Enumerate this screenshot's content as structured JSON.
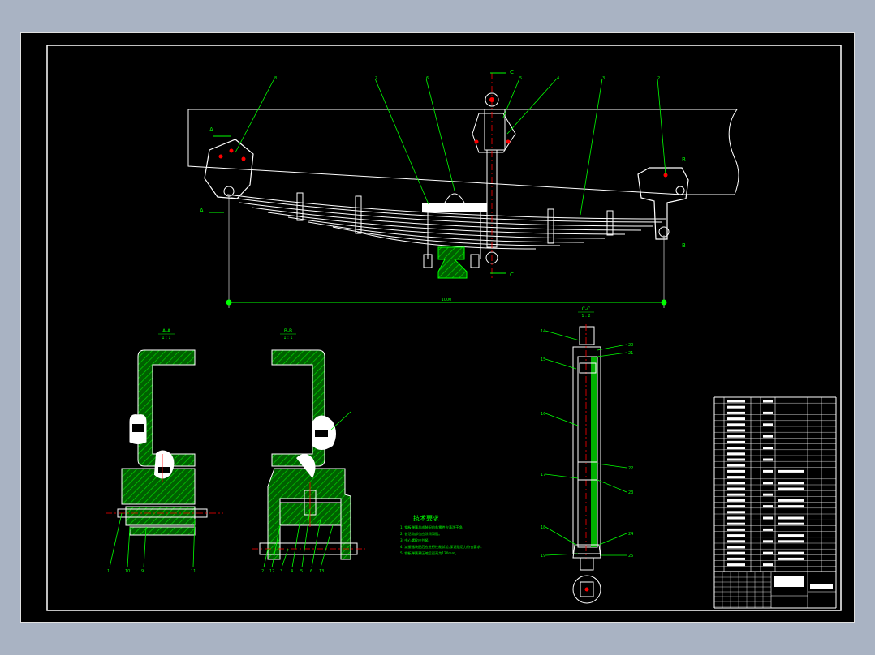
{
  "drawing": {
    "section_cc": {
      "title": "C-C",
      "scale": "1 : 2"
    },
    "section_aa": {
      "title": "A-A",
      "scale": "1 : 1"
    },
    "section_bb": {
      "title": "B-B",
      "scale": "1 : 1"
    },
    "top_labels": [
      "8",
      "7",
      "6",
      "5",
      "4",
      "3",
      "2",
      "1"
    ],
    "cut_marks": {
      "top_c": "C",
      "bottom_c": "C",
      "right_b_top": "B",
      "right_b_bottom": "B",
      "left_a_top": "A",
      "left_a_bottom": "A"
    },
    "dimension": "1000",
    "tech_req": {
      "title": "技术要求",
      "items": [
        "1. 钢板弹簧总成装配前各零件应清洗干净。",
        "2. 各活动部位应涂润滑脂。",
        "3. 中心螺栓应拧紧。",
        "4. 减振器装配后应进行性能试验,保证阻尼力符合要求。",
        "5. 钢板弹簧预压缩后弧高为120mm。"
      ]
    },
    "aa_labels": [
      "1",
      "10",
      "9",
      "11"
    ],
    "bb_labels": [
      "2",
      "12",
      "3",
      "4",
      "5",
      "6",
      "13"
    ],
    "cc_labels": [
      "14",
      "15",
      "16",
      "17",
      "18",
      "19",
      "20",
      "21",
      "22",
      "23",
      "24",
      "25"
    ]
  },
  "colors": {
    "background": "#000000",
    "outline": "#ffffff",
    "leader": "#00ff00",
    "section": "#00a000",
    "hatch": "#00c000",
    "center": "#ff0000",
    "text_green": "#00ff00"
  }
}
